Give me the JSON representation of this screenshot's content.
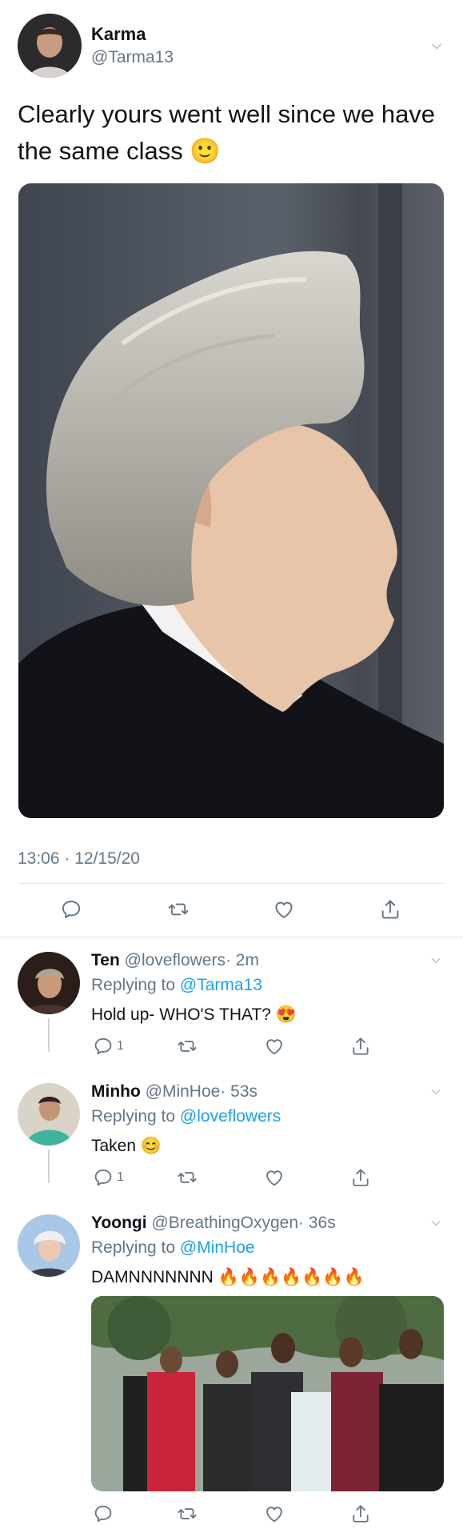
{
  "main_tweet": {
    "name": "Karma",
    "handle": "@Tarma13",
    "text_line1": "Clearly yours went well since we have",
    "text_line2": "the same class",
    "emoji": "🙂",
    "timestamp": "13:06 · 12/15/20"
  },
  "replies": [
    {
      "name": "Ten",
      "handle": "@loveflowers",
      "time": "· 2m",
      "replying_prefix": "Replying to",
      "replying_to": "@Tarma13",
      "text": "Hold up- WHO'S THAT?",
      "emoji": "😍",
      "reply_count": "1"
    },
    {
      "name": "Minho",
      "handle": "@MinHoe",
      "time": "· 53s",
      "replying_prefix": "Replying to",
      "replying_to": "@loveflowers",
      "text": "Taken",
      "emoji": "😊",
      "reply_count": "1"
    },
    {
      "name": "Yoongi",
      "handle": "@BreathingOxygen",
      "time": "· 36s",
      "replying_prefix": "Replying to",
      "replying_to": "@MinHoe",
      "text": "DAMNNNNNNN",
      "emoji": "🔥🔥🔥🔥🔥🔥🔥",
      "reply_count": ""
    }
  ],
  "icons": {
    "reply": "reply-icon",
    "retweet": "retweet-icon",
    "like": "heart-icon",
    "share": "share-icon",
    "more": "chevron-down-icon"
  },
  "colors": {
    "link": "#1da1f2",
    "muted": "#657786",
    "divider": "#e1e8ed"
  }
}
